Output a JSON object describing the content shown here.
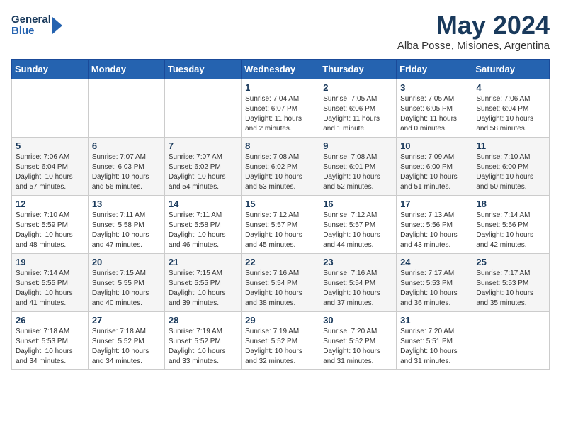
{
  "header": {
    "logo_general": "General",
    "logo_blue": "Blue",
    "month_year": "May 2024",
    "location": "Alba Posse, Misiones, Argentina"
  },
  "weekdays": [
    "Sunday",
    "Monday",
    "Tuesday",
    "Wednesday",
    "Thursday",
    "Friday",
    "Saturday"
  ],
  "weeks": [
    [
      {
        "day": "",
        "info": ""
      },
      {
        "day": "",
        "info": ""
      },
      {
        "day": "",
        "info": ""
      },
      {
        "day": "1",
        "info": "Sunrise: 7:04 AM\nSunset: 6:07 PM\nDaylight: 11 hours\nand 2 minutes."
      },
      {
        "day": "2",
        "info": "Sunrise: 7:05 AM\nSunset: 6:06 PM\nDaylight: 11 hours\nand 1 minute."
      },
      {
        "day": "3",
        "info": "Sunrise: 7:05 AM\nSunset: 6:05 PM\nDaylight: 11 hours\nand 0 minutes."
      },
      {
        "day": "4",
        "info": "Sunrise: 7:06 AM\nSunset: 6:04 PM\nDaylight: 10 hours\nand 58 minutes."
      }
    ],
    [
      {
        "day": "5",
        "info": "Sunrise: 7:06 AM\nSunset: 6:04 PM\nDaylight: 10 hours\nand 57 minutes."
      },
      {
        "day": "6",
        "info": "Sunrise: 7:07 AM\nSunset: 6:03 PM\nDaylight: 10 hours\nand 56 minutes."
      },
      {
        "day": "7",
        "info": "Sunrise: 7:07 AM\nSunset: 6:02 PM\nDaylight: 10 hours\nand 54 minutes."
      },
      {
        "day": "8",
        "info": "Sunrise: 7:08 AM\nSunset: 6:02 PM\nDaylight: 10 hours\nand 53 minutes."
      },
      {
        "day": "9",
        "info": "Sunrise: 7:08 AM\nSunset: 6:01 PM\nDaylight: 10 hours\nand 52 minutes."
      },
      {
        "day": "10",
        "info": "Sunrise: 7:09 AM\nSunset: 6:00 PM\nDaylight: 10 hours\nand 51 minutes."
      },
      {
        "day": "11",
        "info": "Sunrise: 7:10 AM\nSunset: 6:00 PM\nDaylight: 10 hours\nand 50 minutes."
      }
    ],
    [
      {
        "day": "12",
        "info": "Sunrise: 7:10 AM\nSunset: 5:59 PM\nDaylight: 10 hours\nand 48 minutes."
      },
      {
        "day": "13",
        "info": "Sunrise: 7:11 AM\nSunset: 5:58 PM\nDaylight: 10 hours\nand 47 minutes."
      },
      {
        "day": "14",
        "info": "Sunrise: 7:11 AM\nSunset: 5:58 PM\nDaylight: 10 hours\nand 46 minutes."
      },
      {
        "day": "15",
        "info": "Sunrise: 7:12 AM\nSunset: 5:57 PM\nDaylight: 10 hours\nand 45 minutes."
      },
      {
        "day": "16",
        "info": "Sunrise: 7:12 AM\nSunset: 5:57 PM\nDaylight: 10 hours\nand 44 minutes."
      },
      {
        "day": "17",
        "info": "Sunrise: 7:13 AM\nSunset: 5:56 PM\nDaylight: 10 hours\nand 43 minutes."
      },
      {
        "day": "18",
        "info": "Sunrise: 7:14 AM\nSunset: 5:56 PM\nDaylight: 10 hours\nand 42 minutes."
      }
    ],
    [
      {
        "day": "19",
        "info": "Sunrise: 7:14 AM\nSunset: 5:55 PM\nDaylight: 10 hours\nand 41 minutes."
      },
      {
        "day": "20",
        "info": "Sunrise: 7:15 AM\nSunset: 5:55 PM\nDaylight: 10 hours\nand 40 minutes."
      },
      {
        "day": "21",
        "info": "Sunrise: 7:15 AM\nSunset: 5:55 PM\nDaylight: 10 hours\nand 39 minutes."
      },
      {
        "day": "22",
        "info": "Sunrise: 7:16 AM\nSunset: 5:54 PM\nDaylight: 10 hours\nand 38 minutes."
      },
      {
        "day": "23",
        "info": "Sunrise: 7:16 AM\nSunset: 5:54 PM\nDaylight: 10 hours\nand 37 minutes."
      },
      {
        "day": "24",
        "info": "Sunrise: 7:17 AM\nSunset: 5:53 PM\nDaylight: 10 hours\nand 36 minutes."
      },
      {
        "day": "25",
        "info": "Sunrise: 7:17 AM\nSunset: 5:53 PM\nDaylight: 10 hours\nand 35 minutes."
      }
    ],
    [
      {
        "day": "26",
        "info": "Sunrise: 7:18 AM\nSunset: 5:53 PM\nDaylight: 10 hours\nand 34 minutes."
      },
      {
        "day": "27",
        "info": "Sunrise: 7:18 AM\nSunset: 5:52 PM\nDaylight: 10 hours\nand 34 minutes."
      },
      {
        "day": "28",
        "info": "Sunrise: 7:19 AM\nSunset: 5:52 PM\nDaylight: 10 hours\nand 33 minutes."
      },
      {
        "day": "29",
        "info": "Sunrise: 7:19 AM\nSunset: 5:52 PM\nDaylight: 10 hours\nand 32 minutes."
      },
      {
        "day": "30",
        "info": "Sunrise: 7:20 AM\nSunset: 5:52 PM\nDaylight: 10 hours\nand 31 minutes."
      },
      {
        "day": "31",
        "info": "Sunrise: 7:20 AM\nSunset: 5:51 PM\nDaylight: 10 hours\nand 31 minutes."
      },
      {
        "day": "",
        "info": ""
      }
    ]
  ]
}
